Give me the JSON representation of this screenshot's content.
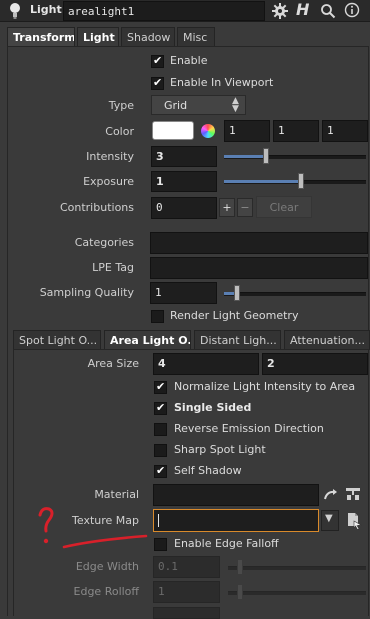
{
  "header": {
    "node_type": "Light",
    "node_name": "arealight1",
    "help_label": "H"
  },
  "main_tabs": [
    {
      "label": "Transform"
    },
    {
      "label": "Light"
    },
    {
      "label": "Shadow"
    },
    {
      "label": "Misc"
    }
  ],
  "light": {
    "enable_label": "Enable",
    "enable_checked": true,
    "enable_viewport_label": "Enable In Viewport",
    "enable_viewport_checked": true,
    "type_label": "Type",
    "type_value": "Grid",
    "color_label": "Color",
    "color_swatch": "#ffffff",
    "color_r": "1",
    "color_g": "1",
    "color_b": "1",
    "intensity_label": "Intensity",
    "intensity_value": "3",
    "intensity_slider_fraction": 0.3,
    "exposure_label": "Exposure",
    "exposure_value": "1",
    "exposure_slider_fraction": 0.55,
    "contributions_label": "Contributions",
    "contributions_value": "0",
    "contributions_plus": "+",
    "contributions_minus": "−",
    "contributions_clear": "Clear",
    "categories_label": "Categories",
    "categories_value": "",
    "lpe_label": "LPE Tag",
    "lpe_value": "",
    "sampling_label": "Sampling Quality",
    "sampling_value": "1",
    "sampling_slider_fraction": 0.05,
    "render_geo_label": "Render Light Geometry",
    "render_geo_checked": false
  },
  "sub_tabs": [
    {
      "label": "Spot Light O..."
    },
    {
      "label": "Area Light O..."
    },
    {
      "label": "Distant Ligh..."
    },
    {
      "label": "Attenuation..."
    }
  ],
  "area": {
    "size_label": "Area Size",
    "size_x": "4",
    "size_y": "2",
    "normalize_label": "Normalize Light Intensity to Area",
    "normalize_checked": true,
    "single_sided_label": "Single Sided",
    "single_sided_checked": true,
    "reverse_label": "Reverse Emission Direction",
    "reverse_checked": false,
    "sharp_label": "Sharp Spot Light",
    "sharp_checked": false,
    "self_shadow_label": "Self Shadow",
    "self_shadow_checked": true,
    "material_label": "Material",
    "material_value": "",
    "texture_label": "Texture Map",
    "texture_value": "",
    "edge_falloff_label": "Enable Edge Falloff",
    "edge_falloff_checked": false,
    "edge_width_label": "Edge Width",
    "edge_width_value": "0.1",
    "edge_rolloff_label": "Edge Rolloff",
    "edge_rolloff_value": "1"
  },
  "colors": {
    "accent_orange": "#d98a2b",
    "annotation_red": "#d8202a",
    "slider_fill": "#5a7fb3"
  }
}
